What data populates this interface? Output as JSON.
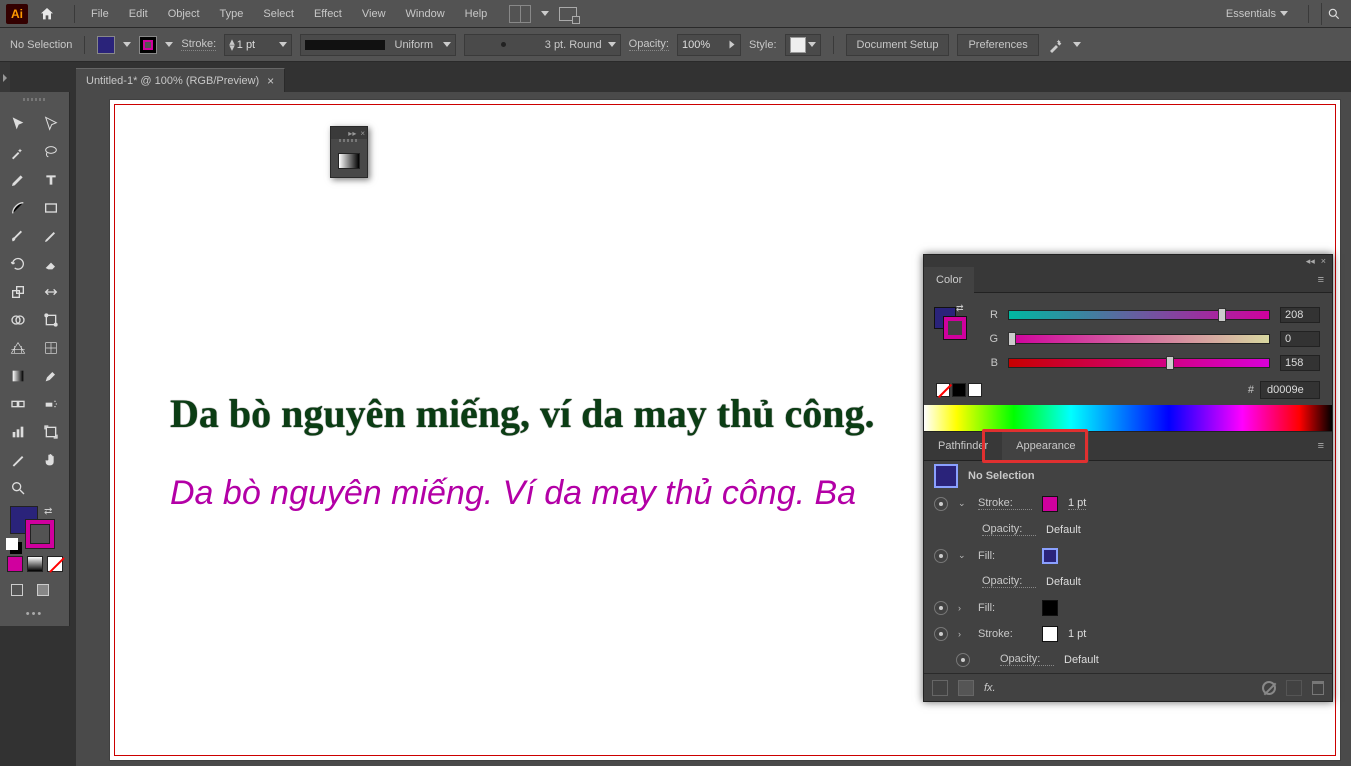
{
  "menubar": {
    "app_logo": "Ai",
    "items": [
      "File",
      "Edit",
      "Object",
      "Type",
      "Select",
      "Effect",
      "View",
      "Window",
      "Help"
    ],
    "workspace": "Essentials"
  },
  "controlbar": {
    "selection_state": "No Selection",
    "stroke_label": "Stroke:",
    "stroke_weight": "1 pt",
    "profile": "Uniform",
    "brush": "3 pt. Round",
    "opacity_label": "Opacity:",
    "opacity_value": "100%",
    "style_label": "Style:",
    "doc_setup": "Document Setup",
    "preferences": "Preferences"
  },
  "document_tab": {
    "title": "Untitled-1* @ 100% (RGB/Preview)"
  },
  "canvas": {
    "text1": "Da bò nguyên miếng, ví da may thủ công.",
    "text2": "Da bò nguyên miếng. Ví da may thủ công. Ba"
  },
  "panels": {
    "color": {
      "tab": "Color",
      "r_label": "R",
      "r_value": "208",
      "g_label": "G",
      "g_value": "0",
      "b_label": "B",
      "b_value": "158",
      "hex_prefix": "#",
      "hex_value": "d0009e"
    },
    "pathfinder_tab": "Pathfinder",
    "appearance": {
      "tab": "Appearance",
      "no_selection": "No Selection",
      "rows": {
        "stroke1_label": "Stroke:",
        "stroke1_val": "1 pt",
        "opacity_label": "Opacity:",
        "opacity_default": "Default",
        "fill1_label": "Fill:",
        "fill2_label": "Fill:",
        "stroke2_label": "Stroke:",
        "stroke2_val": "1 pt"
      },
      "fx_label": "fx."
    }
  },
  "color_slider_positions": {
    "r_pct": 82,
    "g_pct": 1,
    "b_pct": 62
  }
}
